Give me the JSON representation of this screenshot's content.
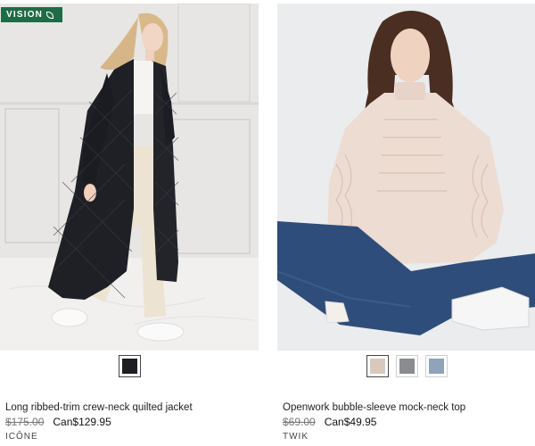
{
  "badge": {
    "label": "VISION"
  },
  "products": [
    {
      "name": "Long ribbed-trim crew-neck quilted jacket",
      "old_price": "$175.00",
      "sale_price": "Can$129.95",
      "brand": "ICÔNE",
      "swatches": [
        {
          "color": "#1c1e22",
          "selected": true
        }
      ]
    },
    {
      "name": "Openwork bubble-sleeve mock-neck top",
      "old_price": "$69.00",
      "sale_price": "Can$49.95",
      "brand": "TWIK",
      "swatches": [
        {
          "color": "#d9c9bd",
          "selected": true
        },
        {
          "color": "#8a8c8f",
          "selected": false
        },
        {
          "color": "#8fa3bb",
          "selected": false
        }
      ]
    }
  ]
}
